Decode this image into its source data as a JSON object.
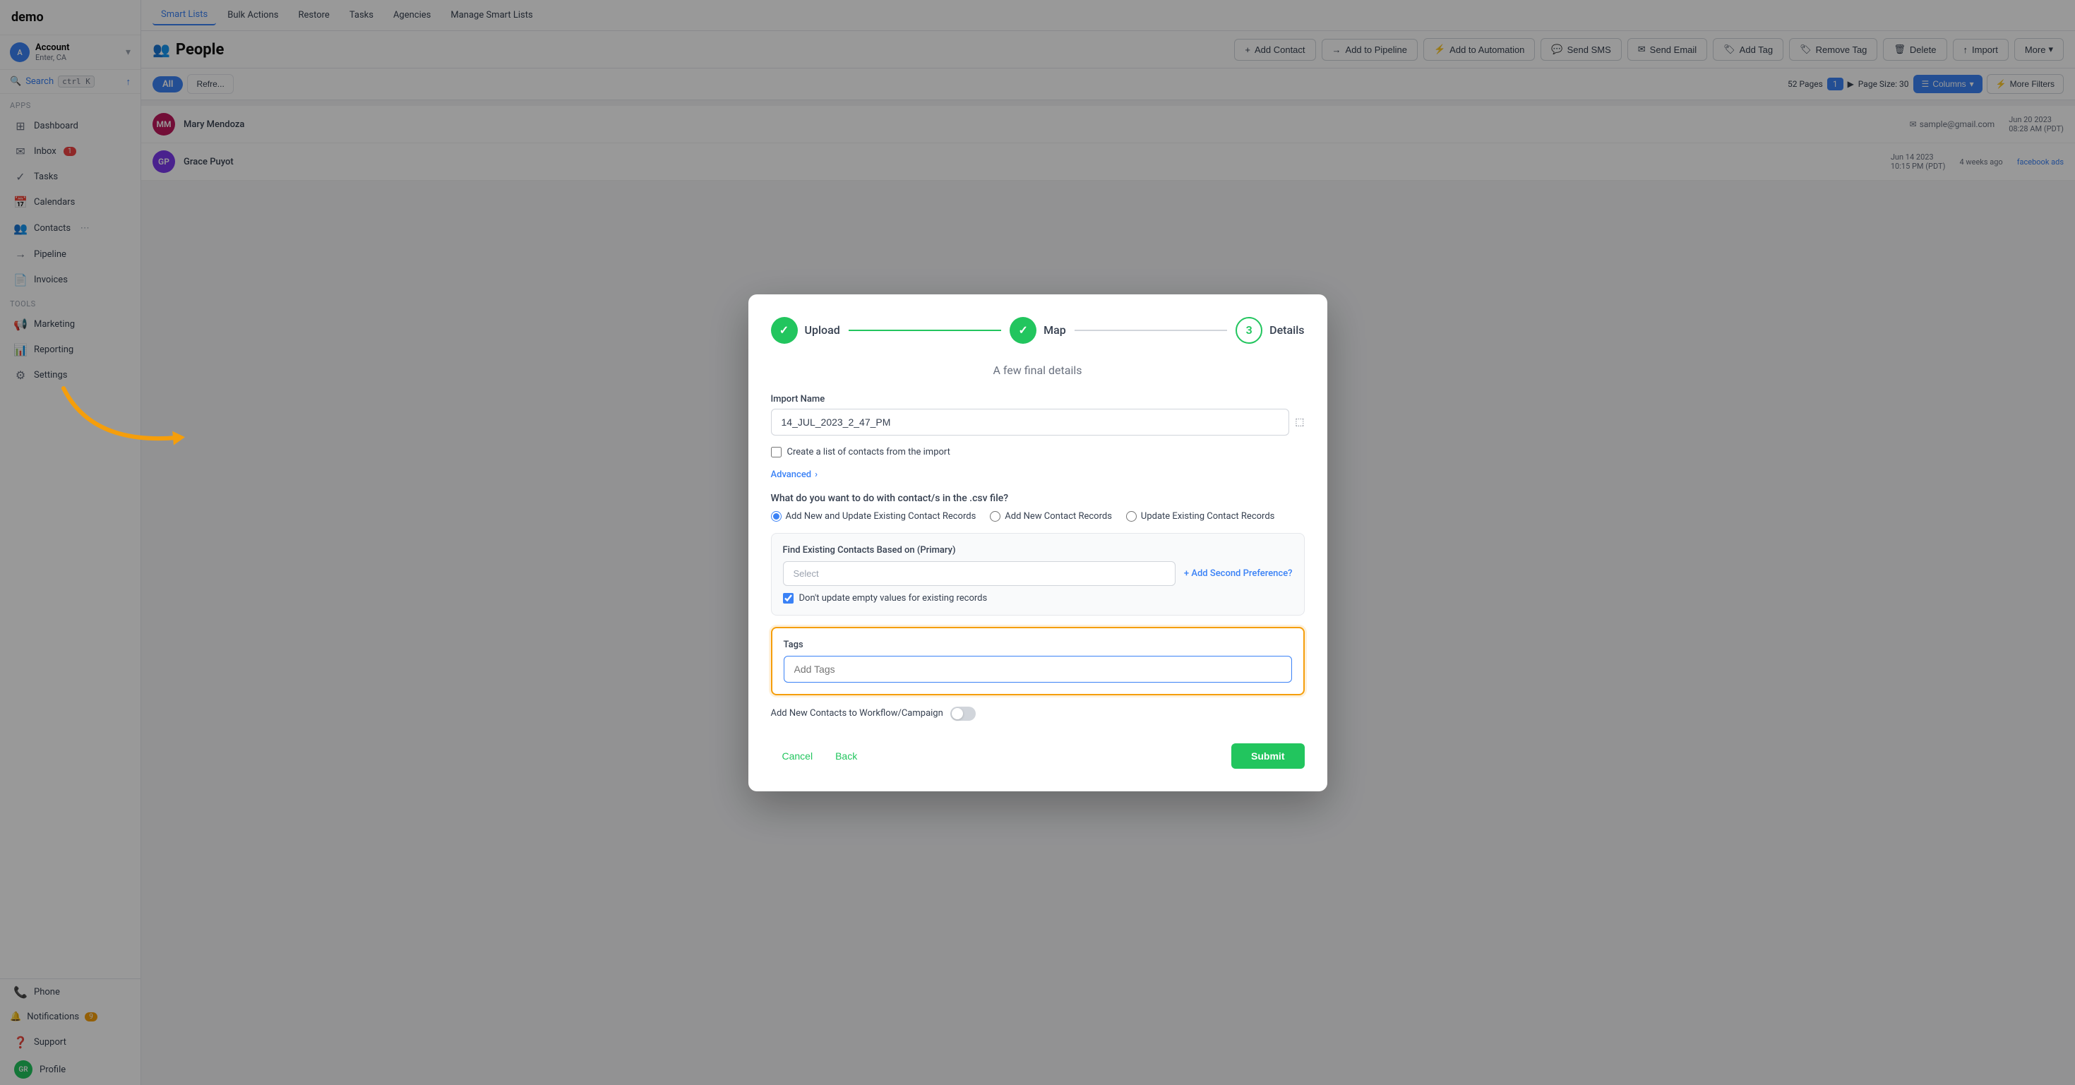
{
  "app": {
    "logo": "demo",
    "account": {
      "name": "Account",
      "sub": "Enter, CA"
    }
  },
  "sidebar": {
    "search_label": "Search",
    "search_kbd": "ctrl K",
    "sections": {
      "apps_label": "Apps",
      "tools_label": "Tools"
    },
    "items": [
      {
        "id": "dashboard",
        "label": "Dashboard",
        "icon": "⊞",
        "active": false,
        "badge": null
      },
      {
        "id": "inbox",
        "label": "Inbox",
        "icon": "✉",
        "active": false,
        "badge": "1"
      },
      {
        "id": "tasks",
        "label": "Tasks",
        "icon": "✓",
        "active": false,
        "badge": null
      },
      {
        "id": "calendars",
        "label": "Calendars",
        "icon": "📅",
        "active": false,
        "badge": null
      },
      {
        "id": "contacts",
        "label": "Contacts",
        "icon": "👥",
        "active": false,
        "badge": null
      },
      {
        "id": "pipeline",
        "label": "Pipeline",
        "icon": "⟶",
        "active": false,
        "badge": null
      },
      {
        "id": "invoices",
        "label": "Invoices",
        "icon": "📄",
        "active": false,
        "badge": null
      },
      {
        "id": "marketing",
        "label": "Marketing",
        "icon": "📢",
        "active": false,
        "badge": null
      },
      {
        "id": "reporting",
        "label": "Reporting",
        "icon": "📊",
        "active": false,
        "badge": null
      },
      {
        "id": "settings",
        "label": "Settings",
        "icon": "⚙",
        "active": false,
        "badge": null
      }
    ],
    "bottom": {
      "phone_label": "Phone",
      "notifications_label": "Notifications",
      "notifications_badge": "9",
      "support_label": "Support",
      "profile_label": "Profile"
    }
  },
  "top_nav": {
    "items": [
      {
        "id": "smart-lists",
        "label": "Smart Lists",
        "active": true
      },
      {
        "id": "bulk-actions",
        "label": "Bulk Actions",
        "active": false
      },
      {
        "id": "restore",
        "label": "Restore",
        "active": false
      },
      {
        "id": "tasks",
        "label": "Tasks",
        "active": false
      },
      {
        "id": "agencies",
        "label": "Agencies",
        "active": false
      },
      {
        "id": "manage-smart-lists",
        "label": "Manage Smart Lists",
        "active": false
      }
    ]
  },
  "sub_header": {
    "title": "People",
    "actions": [
      {
        "id": "add-contact",
        "label": "Add Contact",
        "icon": "+"
      },
      {
        "id": "add-to-pipeline",
        "label": "Add to Pipeline",
        "icon": "⟶"
      },
      {
        "id": "add-to-automation",
        "label": "Add to Automation",
        "icon": "⚡"
      },
      {
        "id": "send-sms",
        "label": "Send SMS",
        "icon": "💬"
      },
      {
        "id": "send-email",
        "label": "Send Email",
        "icon": "✉"
      },
      {
        "id": "add-tag",
        "label": "Add Tag",
        "icon": "🏷"
      },
      {
        "id": "remove-tag",
        "label": "Remove Tag",
        "icon": "🏷"
      },
      {
        "id": "delete",
        "label": "Delete",
        "icon": "🗑"
      },
      {
        "id": "import",
        "label": "Import",
        "icon": "↑"
      }
    ],
    "more_label": "More"
  },
  "toolbar": {
    "all_tab": "All",
    "refresh_label": "Refre...",
    "pagination": {
      "pages": "52 Pages",
      "current_page": "1",
      "page_size": "Page Size: 30"
    },
    "columns_label": "Columns",
    "filters_label": "More Filters"
  },
  "dialog": {
    "title": "A few final details",
    "steps": [
      {
        "id": "upload",
        "label": "Upload",
        "state": "done"
      },
      {
        "id": "map",
        "label": "Map",
        "state": "done"
      },
      {
        "id": "details",
        "label": "Details",
        "state": "active",
        "number": "3"
      }
    ],
    "import_name_label": "Import Name",
    "import_name_value": "14_JUL_2023_2_47_PM",
    "create_list_label": "Create a list of contacts from the import",
    "advanced_label": "Advanced",
    "radio_group": {
      "question": "What do you want to do with contact/s in the .csv file?",
      "options": [
        {
          "id": "add-new-update",
          "label": "Add New and Update Existing Contact Records",
          "checked": true
        },
        {
          "id": "add-new-only",
          "label": "Add New Contact Records",
          "checked": false
        },
        {
          "id": "update-only",
          "label": "Update Existing Contact Records",
          "checked": false
        }
      ]
    },
    "find_contacts": {
      "label": "Find Existing Contacts Based on (Primary)",
      "select_placeholder": "Select",
      "add_preference_label": "+ Add Second Preference?"
    },
    "dont_update_label": "Don't update empty values for existing records",
    "tags": {
      "label": "Tags",
      "placeholder": "Add Tags"
    },
    "workflow_label": "Add New Contacts to Workflow/Campaign",
    "footer": {
      "cancel_label": "Cancel",
      "back_label": "Back",
      "submit_label": "Submit"
    }
  },
  "contacts": [
    {
      "initials": "MM",
      "name": "Mary Mendoza",
      "email": "sample@gmail.com",
      "date": "Jun 20 2023",
      "time": "08:28 AM (PDT)",
      "ago": "",
      "source": "",
      "color": "#be185d"
    },
    {
      "initials": "GP",
      "name": "Grace Puyot",
      "email": "",
      "date": "Jun 14 2023",
      "time": "10:15 PM (PDT)",
      "ago": "4 weeks ago",
      "source": "facebook ads",
      "color": "#7c3aed"
    }
  ]
}
